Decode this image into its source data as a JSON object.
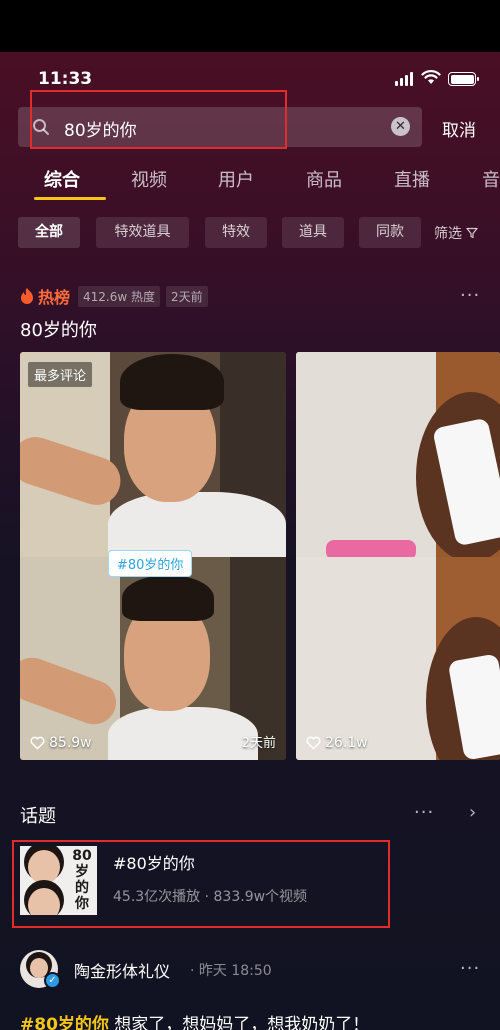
{
  "status_bar": {
    "time": "11:33"
  },
  "search": {
    "query": "80岁的你",
    "cancel_label": "取消"
  },
  "tabs": [
    {
      "label": "综合",
      "active": true
    },
    {
      "label": "视频"
    },
    {
      "label": "用户"
    },
    {
      "label": "商品"
    },
    {
      "label": "直播"
    },
    {
      "label": "音"
    }
  ],
  "filters": {
    "chips": [
      "全部",
      "特效道具",
      "特效",
      "道具",
      "同款"
    ],
    "filter_label": "筛选"
  },
  "hot": {
    "label": "热榜",
    "heat": "412.6w 热度",
    "time": "2天前",
    "title": "80岁的你",
    "more": "···"
  },
  "videos": [
    {
      "tag": "最多评论",
      "hashtag": "#80岁的你",
      "likes": "85.9w",
      "date": "2天前"
    },
    {
      "likes": "26.1w"
    }
  ],
  "topics": {
    "section_title": "话题",
    "more": "···",
    "item": {
      "thumb_text": "80岁的你",
      "title": "#80岁的你",
      "stats": "45.3亿次播放 · 833.9w个视频"
    }
  },
  "post": {
    "author": "陶金形体礼仪",
    "time": "· 昨天 18:50",
    "more": "···",
    "tag": "#80岁的你",
    "text": " 想家了，想妈妈了，想我奶奶了！"
  },
  "colors": {
    "accent_yellow": "#f5c518",
    "hot_orange": "#ff6a3d",
    "annotation_red": "#e12c2c",
    "link_blue": "#2aa3e0"
  }
}
